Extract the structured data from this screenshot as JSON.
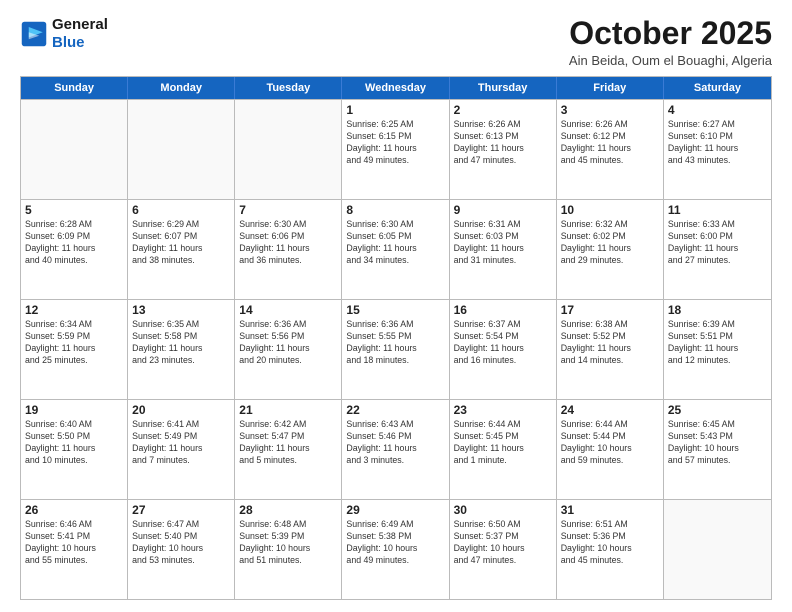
{
  "logo": {
    "line1": "General",
    "line2": "Blue"
  },
  "header": {
    "month": "October 2025",
    "location": "Ain Beida, Oum el Bouaghi, Algeria"
  },
  "weekdays": [
    "Sunday",
    "Monday",
    "Tuesday",
    "Wednesday",
    "Thursday",
    "Friday",
    "Saturday"
  ],
  "weeks": [
    [
      {
        "day": "",
        "info": ""
      },
      {
        "day": "",
        "info": ""
      },
      {
        "day": "",
        "info": ""
      },
      {
        "day": "1",
        "info": "Sunrise: 6:25 AM\nSunset: 6:15 PM\nDaylight: 11 hours\nand 49 minutes."
      },
      {
        "day": "2",
        "info": "Sunrise: 6:26 AM\nSunset: 6:13 PM\nDaylight: 11 hours\nand 47 minutes."
      },
      {
        "day": "3",
        "info": "Sunrise: 6:26 AM\nSunset: 6:12 PM\nDaylight: 11 hours\nand 45 minutes."
      },
      {
        "day": "4",
        "info": "Sunrise: 6:27 AM\nSunset: 6:10 PM\nDaylight: 11 hours\nand 43 minutes."
      }
    ],
    [
      {
        "day": "5",
        "info": "Sunrise: 6:28 AM\nSunset: 6:09 PM\nDaylight: 11 hours\nand 40 minutes."
      },
      {
        "day": "6",
        "info": "Sunrise: 6:29 AM\nSunset: 6:07 PM\nDaylight: 11 hours\nand 38 minutes."
      },
      {
        "day": "7",
        "info": "Sunrise: 6:30 AM\nSunset: 6:06 PM\nDaylight: 11 hours\nand 36 minutes."
      },
      {
        "day": "8",
        "info": "Sunrise: 6:30 AM\nSunset: 6:05 PM\nDaylight: 11 hours\nand 34 minutes."
      },
      {
        "day": "9",
        "info": "Sunrise: 6:31 AM\nSunset: 6:03 PM\nDaylight: 11 hours\nand 31 minutes."
      },
      {
        "day": "10",
        "info": "Sunrise: 6:32 AM\nSunset: 6:02 PM\nDaylight: 11 hours\nand 29 minutes."
      },
      {
        "day": "11",
        "info": "Sunrise: 6:33 AM\nSunset: 6:00 PM\nDaylight: 11 hours\nand 27 minutes."
      }
    ],
    [
      {
        "day": "12",
        "info": "Sunrise: 6:34 AM\nSunset: 5:59 PM\nDaylight: 11 hours\nand 25 minutes."
      },
      {
        "day": "13",
        "info": "Sunrise: 6:35 AM\nSunset: 5:58 PM\nDaylight: 11 hours\nand 23 minutes."
      },
      {
        "day": "14",
        "info": "Sunrise: 6:36 AM\nSunset: 5:56 PM\nDaylight: 11 hours\nand 20 minutes."
      },
      {
        "day": "15",
        "info": "Sunrise: 6:36 AM\nSunset: 5:55 PM\nDaylight: 11 hours\nand 18 minutes."
      },
      {
        "day": "16",
        "info": "Sunrise: 6:37 AM\nSunset: 5:54 PM\nDaylight: 11 hours\nand 16 minutes."
      },
      {
        "day": "17",
        "info": "Sunrise: 6:38 AM\nSunset: 5:52 PM\nDaylight: 11 hours\nand 14 minutes."
      },
      {
        "day": "18",
        "info": "Sunrise: 6:39 AM\nSunset: 5:51 PM\nDaylight: 11 hours\nand 12 minutes."
      }
    ],
    [
      {
        "day": "19",
        "info": "Sunrise: 6:40 AM\nSunset: 5:50 PM\nDaylight: 11 hours\nand 10 minutes."
      },
      {
        "day": "20",
        "info": "Sunrise: 6:41 AM\nSunset: 5:49 PM\nDaylight: 11 hours\nand 7 minutes."
      },
      {
        "day": "21",
        "info": "Sunrise: 6:42 AM\nSunset: 5:47 PM\nDaylight: 11 hours\nand 5 minutes."
      },
      {
        "day": "22",
        "info": "Sunrise: 6:43 AM\nSunset: 5:46 PM\nDaylight: 11 hours\nand 3 minutes."
      },
      {
        "day": "23",
        "info": "Sunrise: 6:44 AM\nSunset: 5:45 PM\nDaylight: 11 hours\nand 1 minute."
      },
      {
        "day": "24",
        "info": "Sunrise: 6:44 AM\nSunset: 5:44 PM\nDaylight: 10 hours\nand 59 minutes."
      },
      {
        "day": "25",
        "info": "Sunrise: 6:45 AM\nSunset: 5:43 PM\nDaylight: 10 hours\nand 57 minutes."
      }
    ],
    [
      {
        "day": "26",
        "info": "Sunrise: 6:46 AM\nSunset: 5:41 PM\nDaylight: 10 hours\nand 55 minutes."
      },
      {
        "day": "27",
        "info": "Sunrise: 6:47 AM\nSunset: 5:40 PM\nDaylight: 10 hours\nand 53 minutes."
      },
      {
        "day": "28",
        "info": "Sunrise: 6:48 AM\nSunset: 5:39 PM\nDaylight: 10 hours\nand 51 minutes."
      },
      {
        "day": "29",
        "info": "Sunrise: 6:49 AM\nSunset: 5:38 PM\nDaylight: 10 hours\nand 49 minutes."
      },
      {
        "day": "30",
        "info": "Sunrise: 6:50 AM\nSunset: 5:37 PM\nDaylight: 10 hours\nand 47 minutes."
      },
      {
        "day": "31",
        "info": "Sunrise: 6:51 AM\nSunset: 5:36 PM\nDaylight: 10 hours\nand 45 minutes."
      },
      {
        "day": "",
        "info": ""
      }
    ]
  ]
}
